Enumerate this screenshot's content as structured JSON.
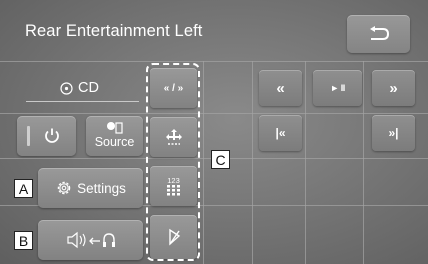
{
  "header": {
    "title": "Rear Entertainment Left",
    "back_icon": "back-arrow-icon"
  },
  "source_label": "CD",
  "left_buttons": {
    "power_icon": "power-icon",
    "source_label": "Source",
    "settings_label": "Settings",
    "audio_swap_icon": "speaker-to-headphones-icon"
  },
  "column_buttons": {
    "seek_mode_label": "« / »",
    "grid_label": "123",
    "icons": [
      "seek-mode-icon",
      "move-cursor-icon",
      "number-keypad-icon",
      "eject-icon"
    ]
  },
  "playback": {
    "rewind_label": "«",
    "play_pause_label": "► II",
    "fast_forward_label": "»",
    "prev_track_label": "|«",
    "next_track_label": "»|"
  },
  "callouts": {
    "a": "A",
    "b": "B",
    "c": "C"
  }
}
